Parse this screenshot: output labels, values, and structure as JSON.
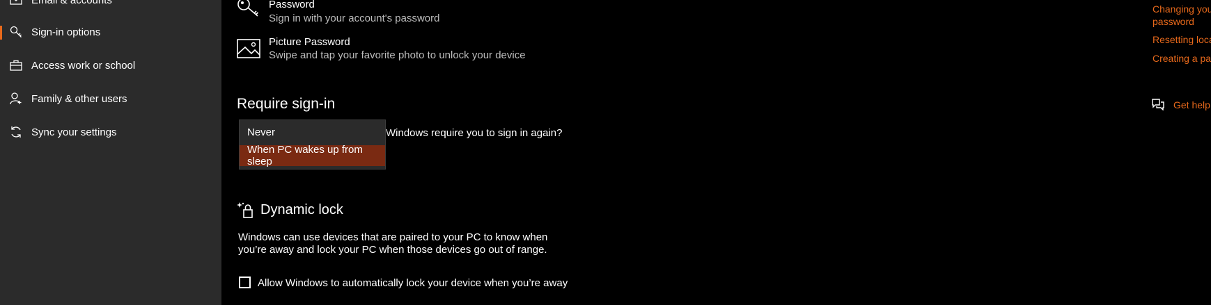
{
  "sidebar": {
    "items": [
      {
        "label": "Email & accounts",
        "icon": "email-icon"
      },
      {
        "label": "Sign-in options",
        "icon": "key-icon",
        "active": true
      },
      {
        "label": "Access work or school",
        "icon": "briefcase-icon"
      },
      {
        "label": "Family & other users",
        "icon": "person-add-icon"
      },
      {
        "label": "Sync your settings",
        "icon": "sync-icon"
      }
    ]
  },
  "main": {
    "password": {
      "title": "Password",
      "subtitle": "Sign in with your account's password"
    },
    "picture_password": {
      "title": "Picture Password",
      "subtitle": "Swipe and tap your favorite photo to unlock your device"
    },
    "require_signin": {
      "heading": "Require sign-in",
      "question": "Windows require you to sign in again?",
      "options": [
        "Never",
        "When PC wakes up from sleep"
      ],
      "selected": "When PC wakes up from sleep"
    },
    "dynamic_lock": {
      "heading": "Dynamic lock",
      "description_line1": "Windows can use devices that are paired to your PC to know when",
      "description_line2": "you’re away and lock your PC when those devices go out of range.",
      "checkbox_label": "Allow Windows to automatically lock your device when you’re away",
      "checked": false
    }
  },
  "right_panel": {
    "links": [
      "Changing your",
      "password",
      "Resetting loca",
      "Creating a pas"
    ],
    "get_help": "Get help"
  },
  "colors": {
    "accent": "#e8691b",
    "selected_bg": "#7a2a12",
    "sidebar_bg": "#2b2b2b"
  }
}
